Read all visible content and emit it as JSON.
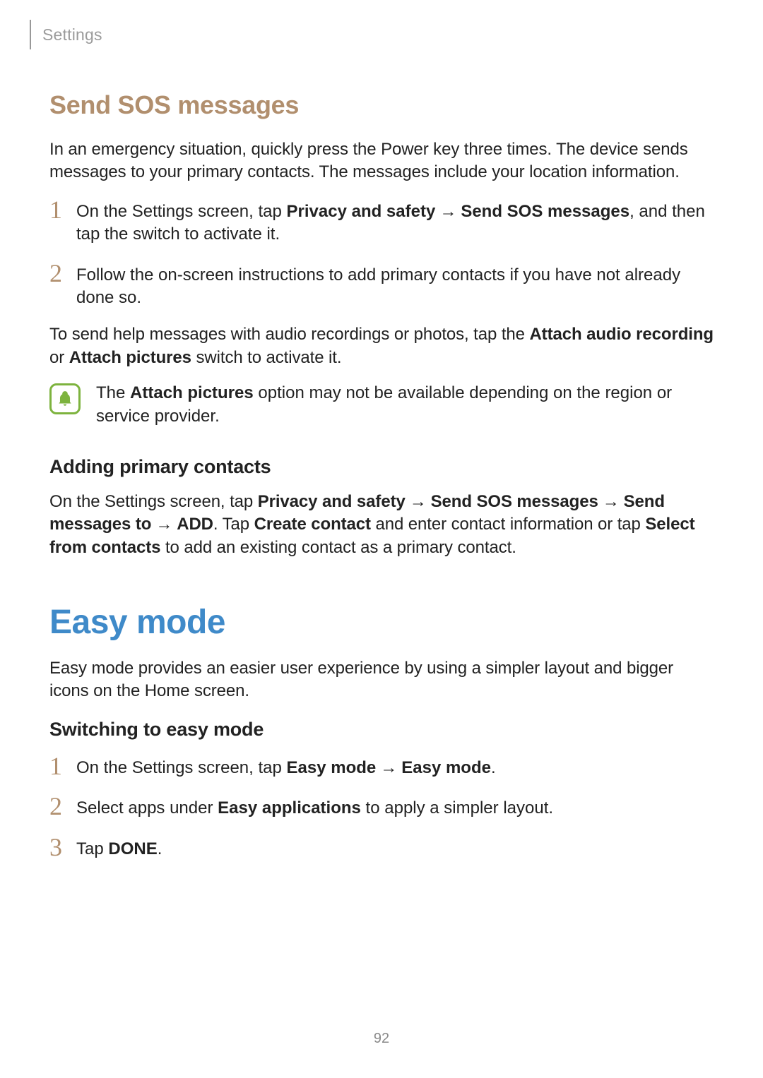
{
  "header": {
    "section": "Settings"
  },
  "sos": {
    "heading": "Send SOS messages",
    "intro": "In an emergency situation, quickly press the Power key three times. The device sends messages to your primary contacts. The messages include your location information.",
    "steps": {
      "n1": "1",
      "s1a": "On the Settings screen, tap ",
      "s1b": "Privacy and safety",
      "s1arrow": "→",
      "s1c": "Send SOS messages",
      "s1d": ", and then tap the switch to activate it.",
      "n2": "2",
      "s2": "Follow the on-screen instructions to add primary contacts if you have not already done so."
    },
    "extra_a": "To send help messages with audio recordings or photos, tap the ",
    "extra_b": "Attach audio recording",
    "extra_c": " or ",
    "extra_d": "Attach pictures",
    "extra_e": " switch to activate it.",
    "note_a": "The ",
    "note_b": "Attach pictures",
    "note_c": " option may not be available depending on the region or service provider."
  },
  "primary": {
    "heading": "Adding primary contacts",
    "p_a": "On the Settings screen, tap ",
    "p_b": "Privacy and safety",
    "arrow": "→",
    "p_c": "Send SOS messages",
    "p_d": "Send messages to",
    "p_e": "ADD",
    "p_f": ". Tap ",
    "p_g": "Create contact",
    "p_h": " and enter contact information or tap ",
    "p_i": "Select from contacts",
    "p_j": " to add an existing contact as a primary contact."
  },
  "easy": {
    "heading": "Easy mode",
    "intro": "Easy mode provides an easier user experience by using a simpler layout and bigger icons on the Home screen.",
    "sub": "Switching to easy mode",
    "n1": "1",
    "s1a": "On the Settings screen, tap ",
    "s1b": "Easy mode",
    "s1arrow": "→",
    "s1c": "Easy mode",
    "s1d": ".",
    "n2": "2",
    "s2a": "Select apps under ",
    "s2b": "Easy applications",
    "s2c": " to apply a simpler layout.",
    "n3": "3",
    "s3a": "Tap ",
    "s3b": "DONE",
    "s3c": "."
  },
  "page_number": "92"
}
